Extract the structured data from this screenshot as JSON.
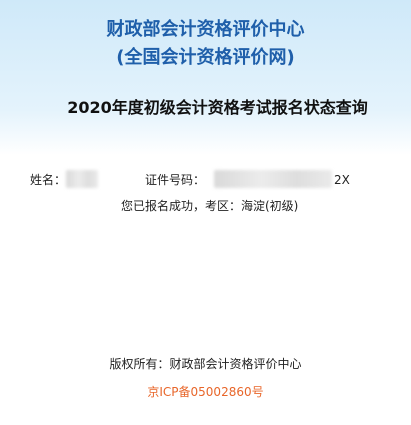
{
  "header": {
    "org_name": "财政部会计资格评价中心",
    "site_name": "(全国会计资格评价网)"
  },
  "query": {
    "title": "2020年度初级会计资格考试报名状态查询"
  },
  "result": {
    "name_label": "姓名：",
    "id_label": "证件号码：",
    "id_visible_suffix": "2X",
    "status_text": "您已报名成功，考区：海淀(初级)"
  },
  "footer": {
    "copyright": "版权所有：财政部会计资格评价中心",
    "icp": "京ICP备05002860号",
    "icp_color": "#e8662a"
  }
}
